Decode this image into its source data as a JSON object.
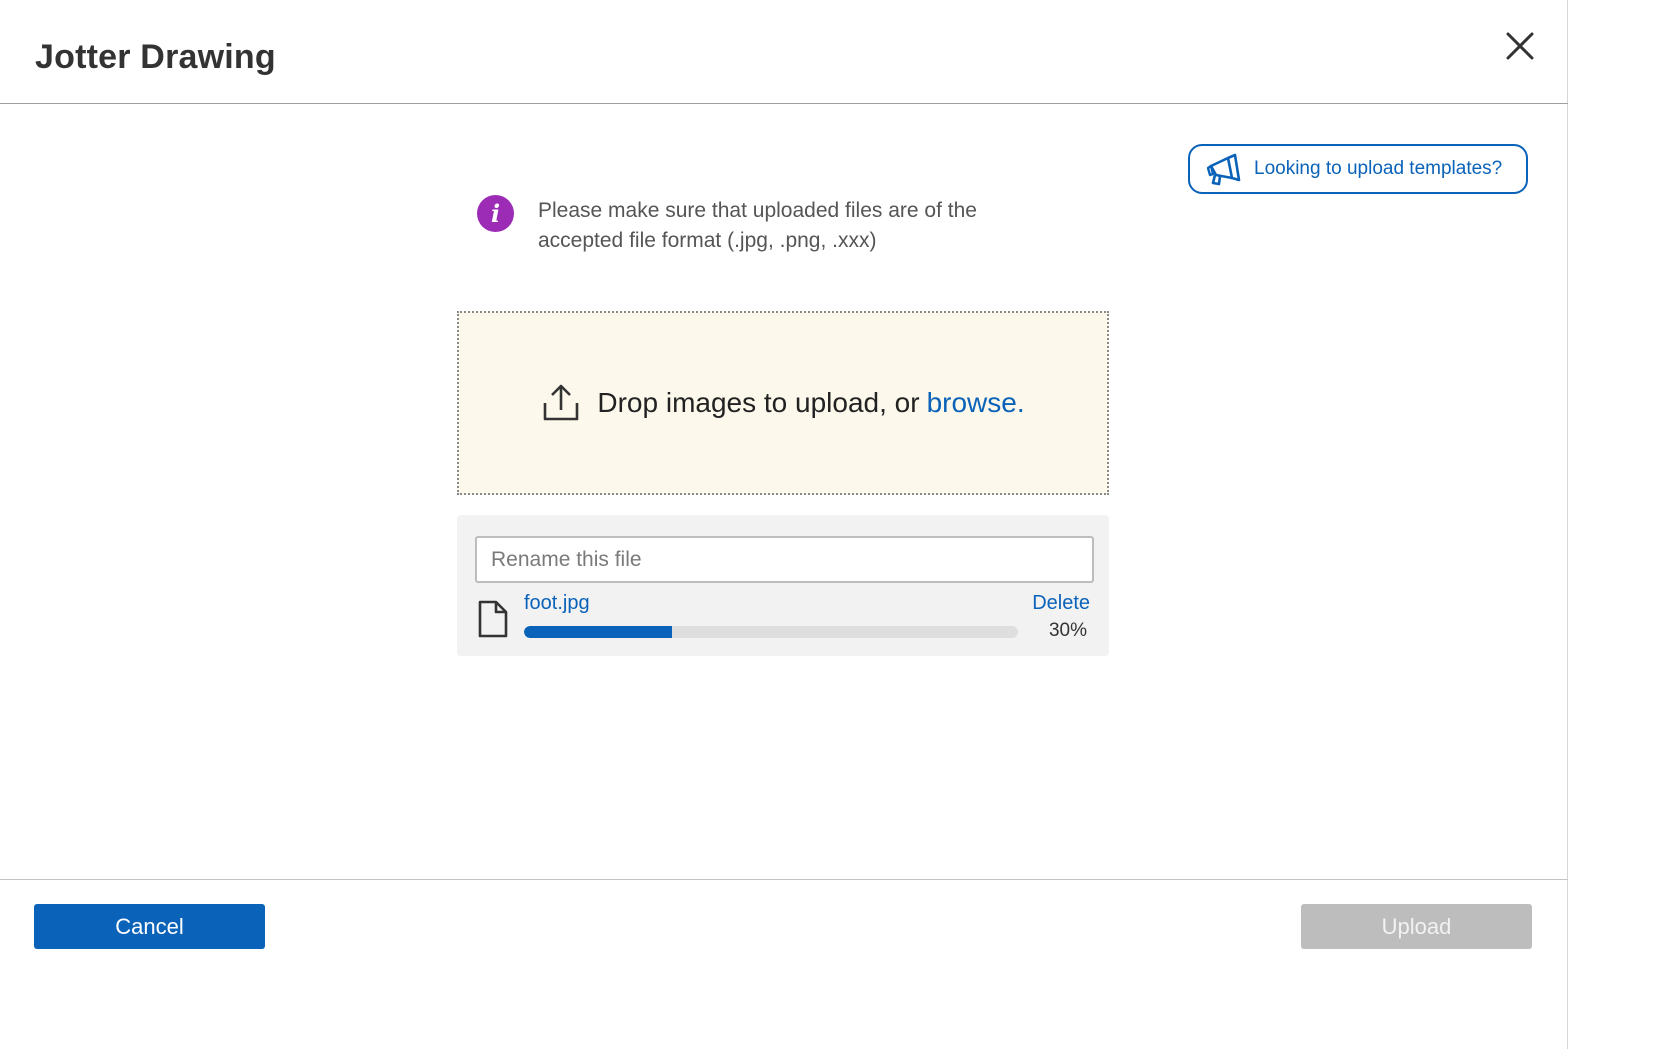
{
  "dialog": {
    "title": "Jotter Drawing",
    "close_icon": "close-icon"
  },
  "templates_button": {
    "label": "Looking to upload templates?",
    "icon": "megaphone-icon"
  },
  "info": {
    "icon": "info-icon",
    "icon_glyph": "i",
    "text": "Please make sure that uploaded files are of the accepted file format (.jpg, .png, .xxx)"
  },
  "dropzone": {
    "icon": "upload-icon",
    "text": "Drop images to upload, or",
    "link": "browse."
  },
  "file": {
    "rename_placeholder": "Rename this file",
    "icon": "file-icon",
    "name": "foot.jpg",
    "delete_label": "Delete",
    "progress": 0.3,
    "progress_label": "30%"
  },
  "footer": {
    "cancel_label": "Cancel",
    "upload_label": "Upload"
  },
  "colors": {
    "accent": "#0a63b8",
    "info": "#9c2bb6",
    "dropzone_bg": "#fcf8ec",
    "disabled": "#bdbdbd"
  }
}
